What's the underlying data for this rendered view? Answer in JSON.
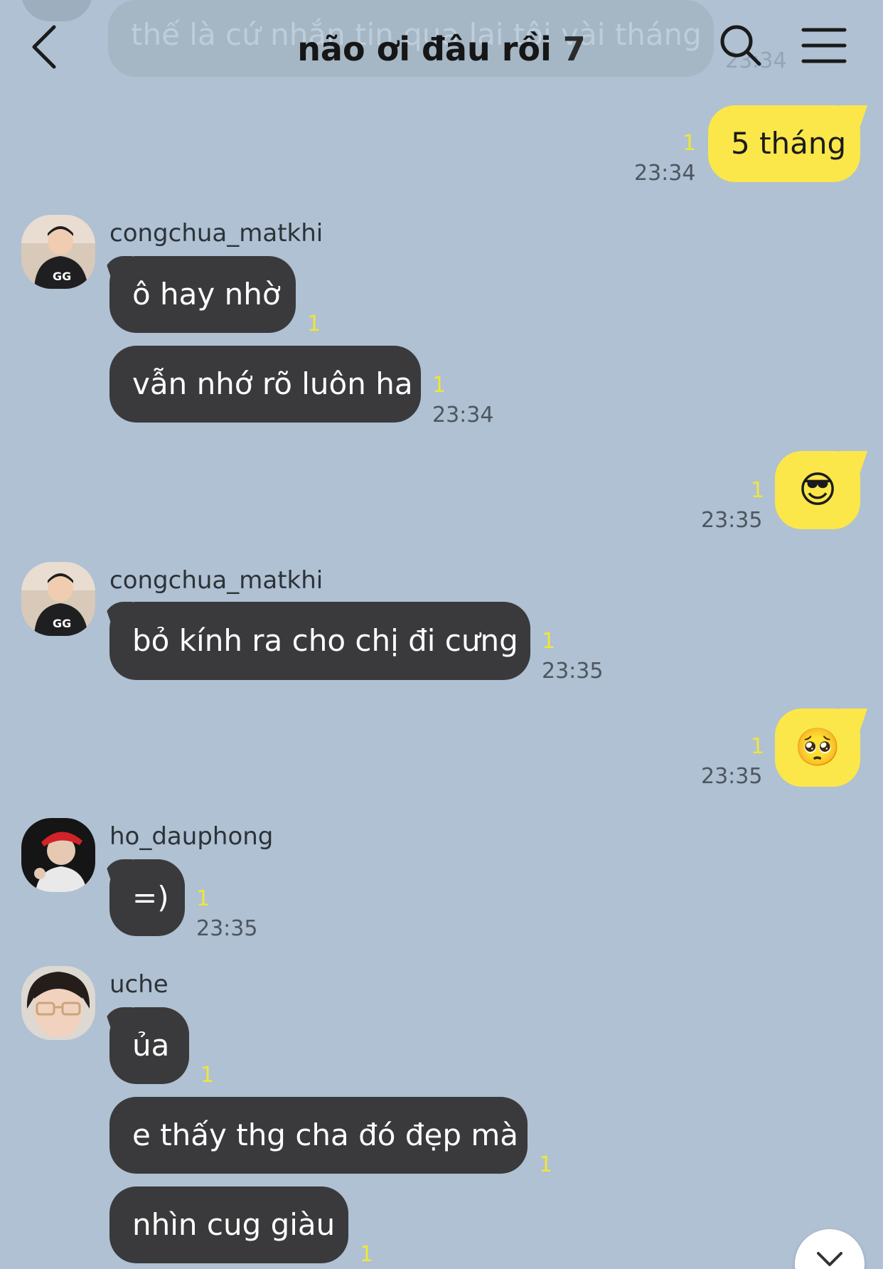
{
  "header": {
    "title": "não ơi đâu rồi",
    "member_count": "7",
    "faded_previous_message": "thế là cứ nhắn tin qua lại tôi vài tháng",
    "faded_previous_time": "23:34"
  },
  "messages": [
    {
      "side": "mine",
      "text": "5 tháng",
      "unread": "1",
      "time": "23:34"
    },
    {
      "side": "theirs",
      "sender": "congchua_matkhi",
      "text": "ô hay nhờ",
      "unread": "1"
    },
    {
      "side": "theirs",
      "text": "vẫn nhớ rõ luôn ha",
      "unread": "1",
      "time": "23:34"
    },
    {
      "side": "mine",
      "emoji": "sunglasses-face",
      "text": "😎",
      "unread": "1",
      "time": "23:35"
    },
    {
      "side": "theirs",
      "sender": "congchua_matkhi",
      "text": "bỏ kính ra cho chị đi cưng",
      "unread": "1",
      "time": "23:35"
    },
    {
      "side": "mine",
      "emoji": "pleading-face",
      "text": "🥺",
      "unread": "1",
      "time": "23:35"
    },
    {
      "side": "theirs",
      "sender": "ho_dauphong",
      "text": "=)",
      "unread": "1",
      "time": "23:35"
    },
    {
      "side": "theirs",
      "sender": "uche",
      "text": "ủa",
      "unread": "1"
    },
    {
      "side": "theirs",
      "text": "e thấy thg cha đó đẹp mà",
      "unread": "1"
    },
    {
      "side": "theirs",
      "text": "nhìn cug giàu",
      "unread": "1"
    }
  ],
  "colors": {
    "background": "#afc1d2",
    "their_bubble": "#3a3a3c",
    "my_bubble": "#fbe74a",
    "unread_count": "#f0e63a"
  }
}
